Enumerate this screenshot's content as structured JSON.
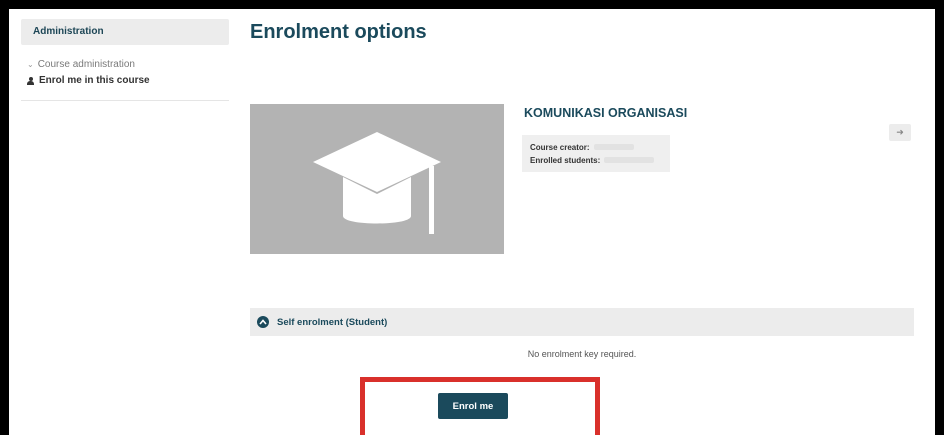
{
  "sidebar": {
    "title": "Administration",
    "course_admin": "Course administration",
    "enrol_link": "Enrol me in this course"
  },
  "main": {
    "heading": "Enrolment options",
    "course_name": "KOMUNIKASI ORGANISASI",
    "course_creator_label": "Course creator:",
    "enrolled_students_label": "Enrolled students:",
    "self_enrolment_title": "Self enrolment (Student)",
    "no_key_text": "No enrolment key required.",
    "enrol_button": "Enrol me"
  },
  "colors": {
    "accent": "#1b4a5c",
    "highlight": "#d9302b"
  },
  "icons": {
    "course_image": "graduation-cap-icon",
    "chevron": "chevron-up-icon",
    "corner": "enter-icon",
    "user": "user-icon"
  }
}
